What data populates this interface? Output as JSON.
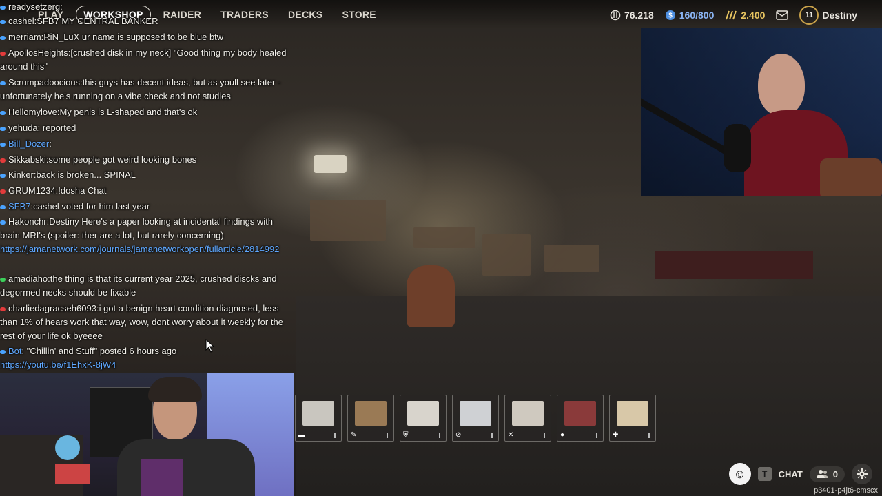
{
  "nav": {
    "tabs": [
      {
        "label": "PLAY",
        "active": false
      },
      {
        "label": "WORKSHOP",
        "active": true
      },
      {
        "label": "RAIDER",
        "active": false
      },
      {
        "label": "TRADERS",
        "active": false
      },
      {
        "label": "DECKS",
        "active": false
      },
      {
        "label": "STORE",
        "active": false
      }
    ]
  },
  "stats": {
    "coins": "76.218",
    "stash": "160/800",
    "tokens": "2.400",
    "level": "11",
    "username": "Destiny"
  },
  "chat": {
    "messages": [
      {
        "user": "readysetzerg",
        "text": "",
        "badge": "#4aa3ff"
      },
      {
        "user": "cashel",
        "text": "SFB7 MY CENTRAL BANKER",
        "badge": "#4aa3ff"
      },
      {
        "user": "merriam",
        "text": "RiN_LuX ur name is supposed to be blue btw",
        "badge": "#4aa3ff"
      },
      {
        "user": "ApollosHeights",
        "text": "[crushed disk in my neck] \"Good thing my body healed around this\"",
        "badge": "#e23b3b"
      },
      {
        "user": "Scrumpadoocious",
        "text": "this guys has decent ideas, but as youll see later - unfortunately he's running on a vibe check and not studies",
        "badge": "#4aa3ff"
      },
      {
        "user": "Hellomylove",
        "text": "My penis is L-shaped and that's ok",
        "badge": "#4aa3ff"
      },
      {
        "user": "yehuda",
        "text": "reported",
        "badge": "#4aa3ff"
      },
      {
        "user": "Bill_Dozer",
        "text": "",
        "badge": "#4aa3ff",
        "blue": true
      },
      {
        "user": "Sikkabski",
        "text": "some people got weird looking bones",
        "badge": "#e23b3b"
      },
      {
        "user": "Kinker",
        "text": "back is broken... SPINAL",
        "badge": "#4aa3ff"
      },
      {
        "user": "GRUM1234",
        "text": "!dosha Chat",
        "badge": "#e23b3b"
      },
      {
        "user": "SFB7",
        "text": "cashel  voted for him last year",
        "badge": "#4aa3ff",
        "blue": true
      },
      {
        "user": "Hakonchr",
        "text": "Destiny Here's a paper looking at incidental findings with brain MRI's (spoiler: ther are a lot, but rarely concerning)",
        "badge": "#4aa3ff"
      },
      {
        "link": "https://jamanetwork.com/journals/jamanetworkopen/fullarticle/2814992"
      },
      {
        "user": "amadiaho",
        "text": "the thing is that its current year 2025, crushed discks and degormed necks should be fixable",
        "badge": "#3ccf5a"
      },
      {
        "user": "charliedagracseh6093",
        "text": "i got a benign heart condition diagnosed, less than 1% of hears work that way, wow, dont worry about it weekly for the rest of your life ok byeeee",
        "badge": "#e23b3b"
      },
      {
        "user": "Bot",
        "text": "\"Chillin' and Stuff\" posted 6 hours ago",
        "badge": "#4aa3ff",
        "blue": true
      },
      {
        "link": "https://youtu.be/f1EhxK-8jW4"
      }
    ]
  },
  "hotbar": {
    "slots": [
      {
        "icon": "▬",
        "color": "#c9c6bf"
      },
      {
        "icon": "✎",
        "color": "#9a7a55"
      },
      {
        "icon": "⛨",
        "color": "#d8d4cc"
      },
      {
        "icon": "⊘",
        "color": "#cfd1d4"
      },
      {
        "icon": "✕",
        "color": "#cfc9bf"
      },
      {
        "icon": "●",
        "color": "#8a3a3a"
      },
      {
        "icon": "✚",
        "color": "#d8c8a8"
      }
    ]
  },
  "controls": {
    "chat_key": "T",
    "chat_label": "CHAT",
    "party_count": "0"
  },
  "build_id": "p3401-p4jt6-cmscx",
  "colors": {
    "link": "#5fa8ff",
    "accent": "#c9a24a"
  }
}
